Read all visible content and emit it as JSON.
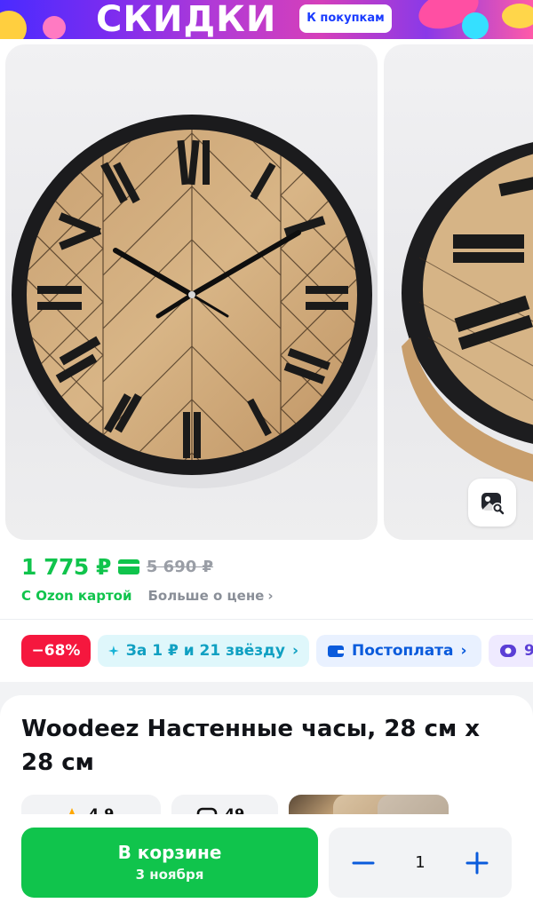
{
  "banner": {
    "title": "СКИДКИ",
    "button_label": "К покупкам"
  },
  "gallery": {
    "visual_search_icon": "image-search-icon"
  },
  "price": {
    "current": "1 775 ₽",
    "old": "5 690 ₽",
    "card_label": "С Ozon картой",
    "more_label": "Больше о цене",
    "chevron": "›"
  },
  "chips": [
    {
      "label": "−68%"
    },
    {
      "label": "За 1 ₽ и 21 звёзду",
      "icon": "star-sparkle-icon"
    },
    {
      "label": "Постоплата",
      "icon": "wallet-icon"
    },
    {
      "label": "9",
      "icon": "subscription-icon"
    }
  ],
  "product": {
    "title": "Woodeez Настенные часы, 28 см х 28 см",
    "rating": "4.9",
    "reviews": "49"
  },
  "cart": {
    "title": "В корзине",
    "date": "3 ноября",
    "quantity": "1"
  },
  "colors": {
    "accent_green": "#10c44c",
    "discount_red": "#f5173e",
    "link_blue": "#0a5bdc"
  }
}
